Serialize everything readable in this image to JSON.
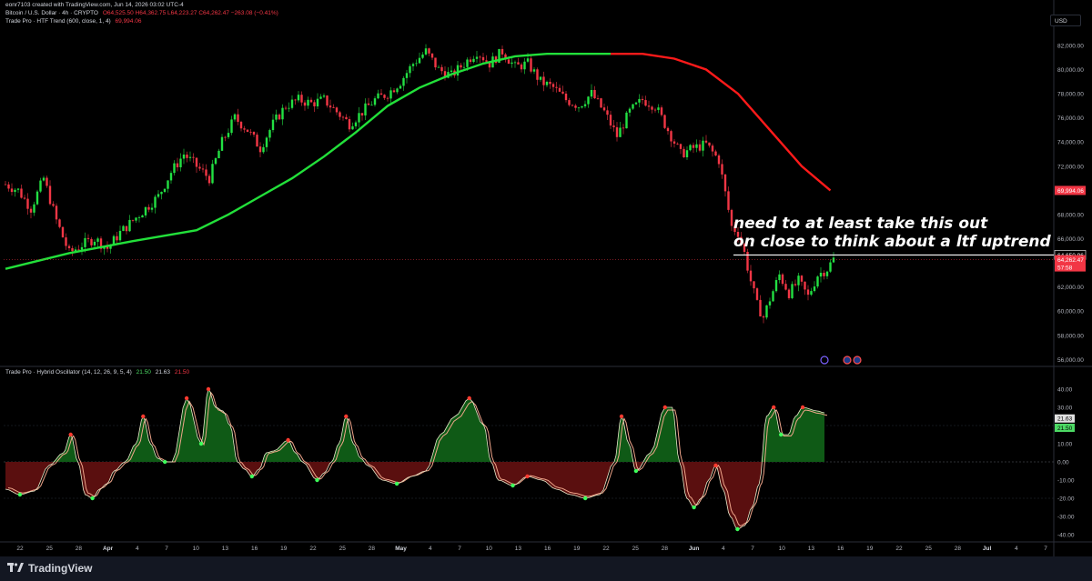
{
  "header": {
    "created_by": "eonr7103 created with TradingView.com, Jun 14, 2026 03:02 UTC-4",
    "symbol": "Bitcoin / U.S. Dollar · 4h · CRYPTO",
    "ohlc": "O64,525.50 H64,362.75 L64,223.27 C64,262.47 −263.08 (−0.41%)",
    "trend_indicator": "Trade Pro · HTF Trend (600, close, 1, 4)",
    "trend_value": "69,994.06",
    "osc_indicator": "Trade Pro · Hybrid Oscillator (14, 12, 26, 9, 5, 4)",
    "osc_v1": "21.50",
    "osc_v2": "21.63",
    "osc_v3": "21.50",
    "currency": "USD"
  },
  "annotation": {
    "line1": "need to at least take this out",
    "line2": "on close to think about a ltf uptrend"
  },
  "footer": {
    "logo_text": "TradingView"
  },
  "colors": {
    "up": "#26a69a",
    "up_bright": "#22e043",
    "down": "#f23645",
    "trend_up": "#22e03a",
    "trend_down": "#ff1a1a",
    "osc_pos_fill": "#0f5a16",
    "osc_neg_fill": "#5a0f0f",
    "osc_line_fast": "#4cd964",
    "osc_line_slow": "#f0a58a"
  },
  "chart_data": [
    {
      "type": "candlestick",
      "title": "Bitcoin / U.S. Dollar · 4h · CRYPTO",
      "ylim": [
        55500,
        83500
      ],
      "yticks": [
        56000,
        58000,
        60000,
        62000,
        64000,
        66000,
        68000,
        70000,
        72000,
        74000,
        76000,
        78000,
        80000,
        82000
      ],
      "ytick_labels": [
        "56,000.00",
        "58,000.00",
        "60,000.00",
        "62,000.00",
        "64,000.00",
        "66,000.00",
        "68,000.00",
        "70,000.00",
        "72,000.00",
        "74,000.00",
        "76,000.00",
        "78,000.00",
        "80,000.00",
        "82,000.00"
      ],
      "x_tick_labels": [
        "22",
        "25",
        "28",
        "Apr",
        "4",
        "7",
        "10",
        "13",
        "16",
        "19",
        "22",
        "25",
        "28",
        "May",
        "4",
        "7",
        "10",
        "13",
        "16",
        "19",
        "22",
        "25",
        "28",
        "Jun",
        "4",
        "7",
        "10",
        "13",
        "16",
        "19",
        "22",
        "25",
        "28",
        "Jul",
        "4",
        "7"
      ],
      "x_tick_bold": [
        "Apr",
        "May",
        "Jun",
        "Jul"
      ],
      "price_path": [
        [
          0,
          70500
        ],
        [
          4,
          70000
        ],
        [
          8,
          68500
        ],
        [
          12,
          71000
        ],
        [
          16,
          67500
        ],
        [
          20,
          64800
        ],
        [
          24,
          65500
        ],
        [
          28,
          66000
        ],
        [
          32,
          65200
        ],
        [
          36,
          66500
        ],
        [
          40,
          67500
        ],
        [
          44,
          68500
        ],
        [
          48,
          69500
        ],
        [
          52,
          71500
        ],
        [
          56,
          73000
        ],
        [
          60,
          72000
        ],
        [
          64,
          71000
        ],
        [
          68,
          74000
        ],
        [
          72,
          76000
        ],
        [
          76,
          75000
        ],
        [
          80,
          73500
        ],
        [
          84,
          75500
        ],
        [
          88,
          77000
        ],
        [
          92,
          77500
        ],
        [
          96,
          77200
        ],
        [
          100,
          77500
        ],
        [
          104,
          76500
        ],
        [
          108,
          75500
        ],
        [
          112,
          76500
        ],
        [
          116,
          77500
        ],
        [
          120,
          78000
        ],
        [
          124,
          79000
        ],
        [
          128,
          80500
        ],
        [
          132,
          81500
        ],
        [
          136,
          80000
        ],
        [
          140,
          79500
        ],
        [
          144,
          80500
        ],
        [
          148,
          81500
        ],
        [
          152,
          80500
        ],
        [
          156,
          81500
        ],
        [
          160,
          80200
        ],
        [
          164,
          80500
        ],
        [
          168,
          79000
        ],
        [
          172,
          78500
        ],
        [
          176,
          77500
        ],
        [
          180,
          77000
        ],
        [
          184,
          78000
        ],
        [
          188,
          76500
        ],
        [
          192,
          74500
        ],
        [
          196,
          76500
        ],
        [
          200,
          77500
        ],
        [
          204,
          77000
        ],
        [
          208,
          75000
        ],
        [
          212,
          73000
        ],
        [
          216,
          73500
        ],
        [
          220,
          73800
        ],
        [
          224,
          72500
        ],
        [
          228,
          67000
        ],
        [
          230,
          66500
        ],
        [
          232,
          64800
        ],
        [
          234,
          62500
        ],
        [
          236,
          60500
        ],
        [
          238,
          59500
        ],
        [
          240,
          61000
        ],
        [
          243,
          63000
        ],
        [
          246,
          61500
        ],
        [
          249,
          62500
        ],
        [
          252,
          61200
        ],
        [
          255,
          63000
        ],
        [
          258,
          63500
        ],
        [
          260,
          64300
        ]
      ],
      "trend_line": {
        "name": "Trade Pro · HTF Trend",
        "up_segment": [
          [
            0,
            63500
          ],
          [
            20,
            64800
          ],
          [
            40,
            65800
          ],
          [
            60,
            66700
          ],
          [
            70,
            68000
          ],
          [
            80,
            69500
          ],
          [
            90,
            71000
          ],
          [
            100,
            72800
          ],
          [
            110,
            74800
          ],
          [
            120,
            77000
          ],
          [
            130,
            78500
          ],
          [
            140,
            79600
          ],
          [
            150,
            80500
          ],
          [
            160,
            81100
          ],
          [
            170,
            81300
          ],
          [
            190,
            81300
          ]
        ],
        "down_segment": [
          [
            190,
            81300
          ],
          [
            200,
            81300
          ],
          [
            210,
            80900
          ],
          [
            220,
            80000
          ],
          [
            230,
            78000
          ],
          [
            240,
            75000
          ],
          [
            250,
            72000
          ],
          [
            259,
            70000
          ]
        ]
      },
      "horizontal_lines": [
        {
          "price": 64650.96,
          "label": "64,650.96",
          "color": "#ffffff"
        }
      ],
      "price_labels": [
        {
          "price": 69994.06,
          "label": "69,994.06",
          "color": "#f23645"
        },
        {
          "price": 64650.96,
          "label": "64,650.96",
          "color": "#ffffff"
        },
        {
          "price": 64262.47,
          "label": "64,262.47",
          "color": "#f23645"
        }
      ],
      "countdown": "57:58"
    },
    {
      "type": "area",
      "title": "Trade Pro · Hybrid Oscillator (14, 12, 26, 9, 5, 4)",
      "ylim": [
        -42,
        44
      ],
      "yticks": [
        -40,
        -30,
        -20,
        -10,
        0,
        10,
        20,
        30,
        40
      ],
      "ytick_labels": [
        "-40.00",
        "-30.00",
        "-20.00",
        "-10.00",
        "0.00",
        "10.00",
        "20.00",
        "30.00",
        "40.00"
      ],
      "series": [
        {
          "name": "Hybrid Oscillator",
          "points": [
            [
              0,
              -15
            ],
            [
              4,
              -18
            ],
            [
              8,
              -16
            ],
            [
              12,
              -2
            ],
            [
              16,
              5
            ],
            [
              18,
              15
            ],
            [
              20,
              0
            ],
            [
              22,
              -18
            ],
            [
              24,
              -20
            ],
            [
              26,
              -15
            ],
            [
              28,
              -12
            ],
            [
              30,
              -5
            ],
            [
              33,
              0
            ],
            [
              36,
              10
            ],
            [
              38,
              25
            ],
            [
              40,
              10
            ],
            [
              42,
              2
            ],
            [
              44,
              0
            ],
            [
              46,
              0
            ],
            [
              50,
              35
            ],
            [
              54,
              10
            ],
            [
              56,
              40
            ],
            [
              58,
              30
            ],
            [
              60,
              28
            ],
            [
              62,
              20
            ],
            [
              64,
              0
            ],
            [
              66,
              -4
            ],
            [
              68,
              -8
            ],
            [
              70,
              -4
            ],
            [
              72,
              5
            ],
            [
              74,
              6
            ],
            [
              78,
              12
            ],
            [
              80,
              5
            ],
            [
              82,
              0
            ],
            [
              86,
              -10
            ],
            [
              88,
              -6
            ],
            [
              90,
              0
            ],
            [
              92,
              10
            ],
            [
              94,
              25
            ],
            [
              96,
              10
            ],
            [
              98,
              2
            ],
            [
              100,
              -2
            ],
            [
              104,
              -10
            ],
            [
              108,
              -12
            ],
            [
              112,
              -8
            ],
            [
              116,
              -5
            ],
            [
              120,
              15
            ],
            [
              124,
              25
            ],
            [
              128,
              35
            ],
            [
              132,
              20
            ],
            [
              134,
              0
            ],
            [
              136,
              -10
            ],
            [
              140,
              -13
            ],
            [
              144,
              -8
            ],
            [
              148,
              -10
            ],
            [
              152,
              -15
            ],
            [
              156,
              -18
            ],
            [
              160,
              -20
            ],
            [
              164,
              -18
            ],
            [
              168,
              0
            ],
            [
              170,
              25
            ],
            [
              172,
              10
            ],
            [
              174,
              -5
            ],
            [
              178,
              5
            ],
            [
              182,
              30
            ],
            [
              184,
              30
            ],
            [
              186,
              0
            ],
            [
              188,
              -20
            ],
            [
              190,
              -25
            ],
            [
              192,
              -20
            ],
            [
              194,
              -10
            ],
            [
              196,
              -2
            ],
            [
              198,
              -15
            ],
            [
              200,
              -30
            ],
            [
              202,
              -37
            ],
            [
              204,
              -35
            ],
            [
              206,
              -25
            ],
            [
              208,
              -12
            ],
            [
              210,
              25
            ],
            [
              212,
              30
            ],
            [
              214,
              15
            ],
            [
              216,
              15
            ],
            [
              218,
              25
            ],
            [
              220,
              30
            ],
            [
              224,
              28
            ],
            [
              226,
              27
            ]
          ]
        }
      ]
    }
  ]
}
